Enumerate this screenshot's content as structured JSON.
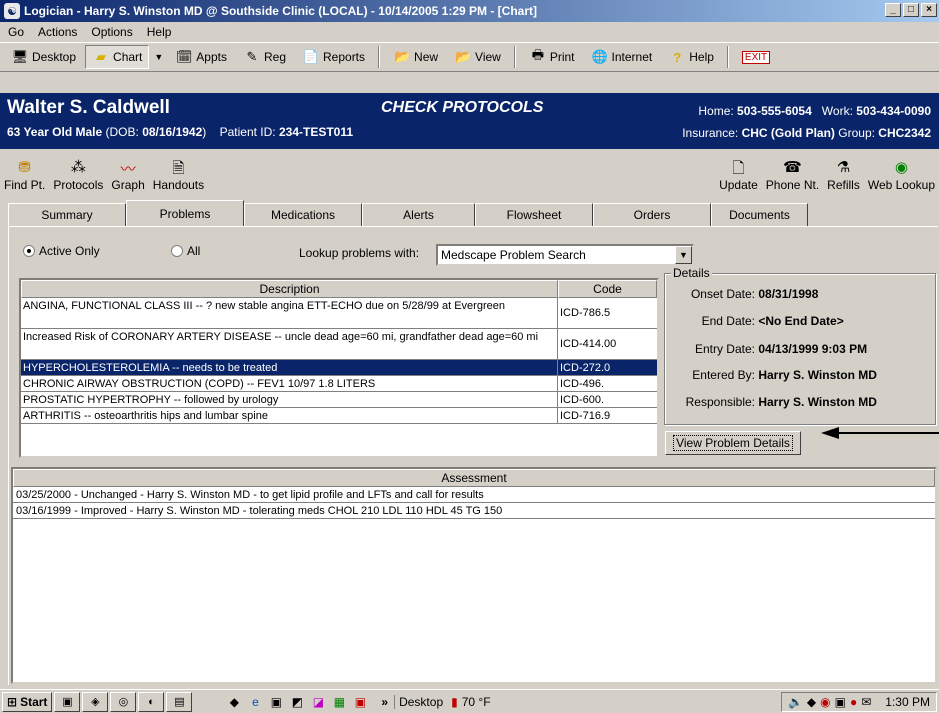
{
  "window": {
    "title": "Logician - Harry S. Winston MD @ Southside Clinic (LOCAL) - 10/14/2005 1:29 PM - [Chart]",
    "controls": [
      "_",
      "□",
      "×"
    ]
  },
  "menu": [
    "Go",
    "Actions",
    "Options",
    "Help"
  ],
  "toolbar": {
    "desktop": "Desktop",
    "chart": "Chart",
    "appts": "Appts",
    "reg": "Reg",
    "reports": "Reports",
    "new": "New",
    "view": "View",
    "print": "Print",
    "internet": "Internet",
    "help": "Help",
    "exit": "EXIT"
  },
  "patient": {
    "name": "Walter S. Caldwell",
    "age_sex": "63 Year Old Male",
    "dob_label": "(DOB:",
    "dob": "08/16/1942",
    "dob_close": ")",
    "id_label": "Patient ID:",
    "id": "234-TEST011",
    "screen_title": "CHECK PROTOCOLS",
    "home_label": "Home:",
    "home": "503-555-6054",
    "work_label": "Work:",
    "work": "503-434-0090",
    "insurance_label": "Insurance:",
    "insurance": "CHC (Gold Plan)",
    "group_label": "Group:",
    "group": "CHC2342"
  },
  "toolbar2": {
    "find_pt": "Find Pt.",
    "protocols": "Protocols",
    "graph": "Graph",
    "handouts": "Handouts",
    "update": "Update",
    "phone_nt": "Phone Nt.",
    "refills": "Refills",
    "web_lookup": "Web Lookup"
  },
  "tabs": [
    "Summary",
    "Problems",
    "Medications",
    "Alerts",
    "Flowsheet",
    "Orders",
    "Documents"
  ],
  "filter": {
    "active_only": "Active Only",
    "all": "All",
    "lookup_label": "Lookup problems with:",
    "lookup_value": "Medscape Problem Search"
  },
  "problems": {
    "headers": [
      "Description",
      "Code"
    ],
    "rows": [
      {
        "desc": "ANGINA, FUNCTIONAL CLASS III -- ? new stable angina ETT-ECHO due on 5/28/99 at Evergreen",
        "code": "ICD-786.5"
      },
      {
        "desc": "Increased Risk of  CORONARY ARTERY DISEASE -- uncle dead age=60 mi, grandfather dead age=60 mi",
        "code": "ICD-414.00"
      },
      {
        "desc": "HYPERCHOLESTEROLEMIA -- needs to be treated",
        "code": "ICD-272.0"
      },
      {
        "desc": "CHRONIC AIRWAY OBSTRUCTION (COPD) -- FEV1 10/97 1.8 LITERS",
        "code": "ICD-496."
      },
      {
        "desc": "PROSTATIC HYPERTROPHY -- followed by urology",
        "code": "ICD-600."
      },
      {
        "desc": "ARTHRITIS -- osteoarthritis hips and lumbar spine",
        "code": "ICD-716.9"
      }
    ]
  },
  "details": {
    "legend": "Details",
    "onset_label": "Onset Date:",
    "onset": "08/31/1998",
    "end_label": "End Date:",
    "end": "<No End Date>",
    "entry_label": "Entry Date:",
    "entry": "04/13/1999 9:03 PM",
    "entered_label": "Entered By:",
    "entered": "Harry S. Winston MD",
    "resp_label": "Responsible:",
    "resp": "Harry S. Winston MD",
    "button": "View Problem Details"
  },
  "assessment": {
    "header": "Assessment",
    "rows": [
      "03/25/2000 - Unchanged - Harry S. Winston MD - to get lipid profile and LFTs and call for results",
      "03/16/1999 - Improved - Harry S. Winston MD - tolerating meds CHOL 210 LDL 110 HDL 45 TG 150"
    ]
  },
  "taskbar": {
    "start": "Start",
    "desktop": "Desktop",
    "chevron": "»",
    "weather": "70 °F",
    "time": "1:30 PM"
  }
}
